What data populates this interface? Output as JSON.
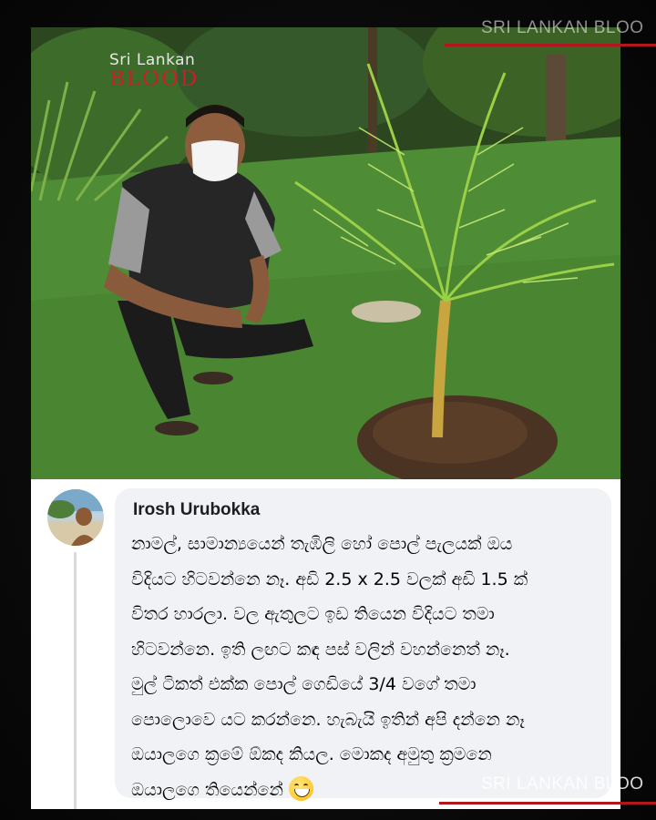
{
  "logo": {
    "line1": "Sri Lankan",
    "line2": "BLOOD"
  },
  "watermark": {
    "top": "SRI LANKAN BLOO",
    "bottom": "SRI LANKAN BLOO",
    "accent_color": "#b4161d"
  },
  "comment": {
    "author": "Irosh Urubokka",
    "lines": [
      "නාමල්, සාමාන්‍යයෙන් තැඹිලි හෝ පොල් පැලයක් ඔය",
      "විදියට හිටවන්නෙ නෑ. අඩි 2.5 x 2.5 වලක් අඩි 1.5 ක්",
      "විතර හාරලා. වල ඇතුලට ඉඩ තියෙන විදියට තමා",
      "හිටවන්නෙ. ඉති ලඟට කඳ පස් වලින් වහන්නෙත් නෑ.",
      "මුල් ටිකත් එක්ක පොල් ගෙඩියේ 3/4 වගේ තමා",
      "පොලොවෙ යට කරන්නෙ. හැබැයි ඉතින් අපි දන්නෙ නෑ",
      "ඔයාලගෙ ක්‍රමේ ඕකද කියල. මොකද අමුතු ක්‍රමනෙ",
      "ඔයාලගෙ තියෙන්නේ"
    ],
    "emoji": "grinning-face-emoji",
    "bubble_color": "#f0f2f5"
  }
}
